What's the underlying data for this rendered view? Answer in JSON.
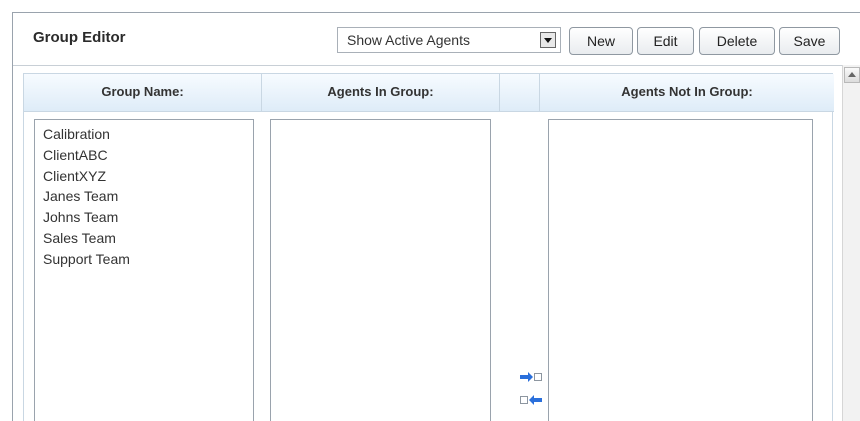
{
  "header": {
    "title": "Group Editor",
    "filter_select": {
      "selected": "Show Active Agents"
    },
    "buttons": {
      "new": "New",
      "edit": "Edit",
      "delete": "Delete",
      "save": "Save"
    }
  },
  "columns": {
    "group_name": "Group Name:",
    "agents_in_group": "Agents In Group:",
    "agents_not_in_group": "Agents Not In Group:"
  },
  "groups": [
    "Calibration",
    "ClientABC",
    "ClientXYZ",
    "Janes Team",
    "Johns Team",
    "Sales Team",
    "Support Team"
  ],
  "icons": {
    "add_agent": "arrow-right-into-box-icon",
    "remove_agent": "arrow-left-out-of-box-icon"
  },
  "colors": {
    "header_gradient_top": "#f7fbff",
    "header_gradient_bottom": "#deecf8",
    "arrow_blue": "#2a6fdb"
  }
}
